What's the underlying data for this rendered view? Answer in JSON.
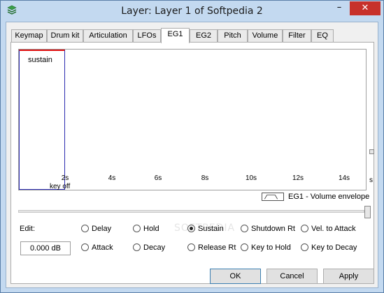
{
  "window": {
    "title": "Layer: Layer 1 of Softpedia 2",
    "minimize_glyph": "–",
    "close_glyph": "✕"
  },
  "tabs": [
    {
      "label": "Keymap"
    },
    {
      "label": "Drum kit"
    },
    {
      "label": "Articulation"
    },
    {
      "label": "LFOs"
    },
    {
      "label": "EG1",
      "active": true
    },
    {
      "label": "EG2"
    },
    {
      "label": "Pitch"
    },
    {
      "label": "Volume"
    },
    {
      "label": "Filter"
    },
    {
      "label": "EQ"
    }
  ],
  "envelope": {
    "segment_label": "sustain",
    "time_ticks": [
      "2s",
      "4s",
      "6s",
      "8s",
      "10s",
      "12s",
      "14s"
    ],
    "key_off_label": "key off",
    "axis_unit": "s",
    "name": "EG1 - Volume envelope"
  },
  "edit": {
    "label": "Edit:",
    "value": "0.000 dB",
    "selected": "Sustain",
    "options_row1": [
      "Delay",
      "Hold",
      "Sustain",
      "Shutdown Rt",
      "Vel. to Attack"
    ],
    "options_row2": [
      "Attack",
      "Decay",
      "Release Rt",
      "Key to Hold",
      "Key to Decay"
    ]
  },
  "buttons": {
    "ok": "OK",
    "cancel": "Cancel",
    "apply": "Apply"
  },
  "watermark": "SOFTPEDIA",
  "colors": {
    "sustain_top": "#e01010",
    "envelope_outline": "#2b2bb0",
    "close_button": "#c7312a"
  }
}
